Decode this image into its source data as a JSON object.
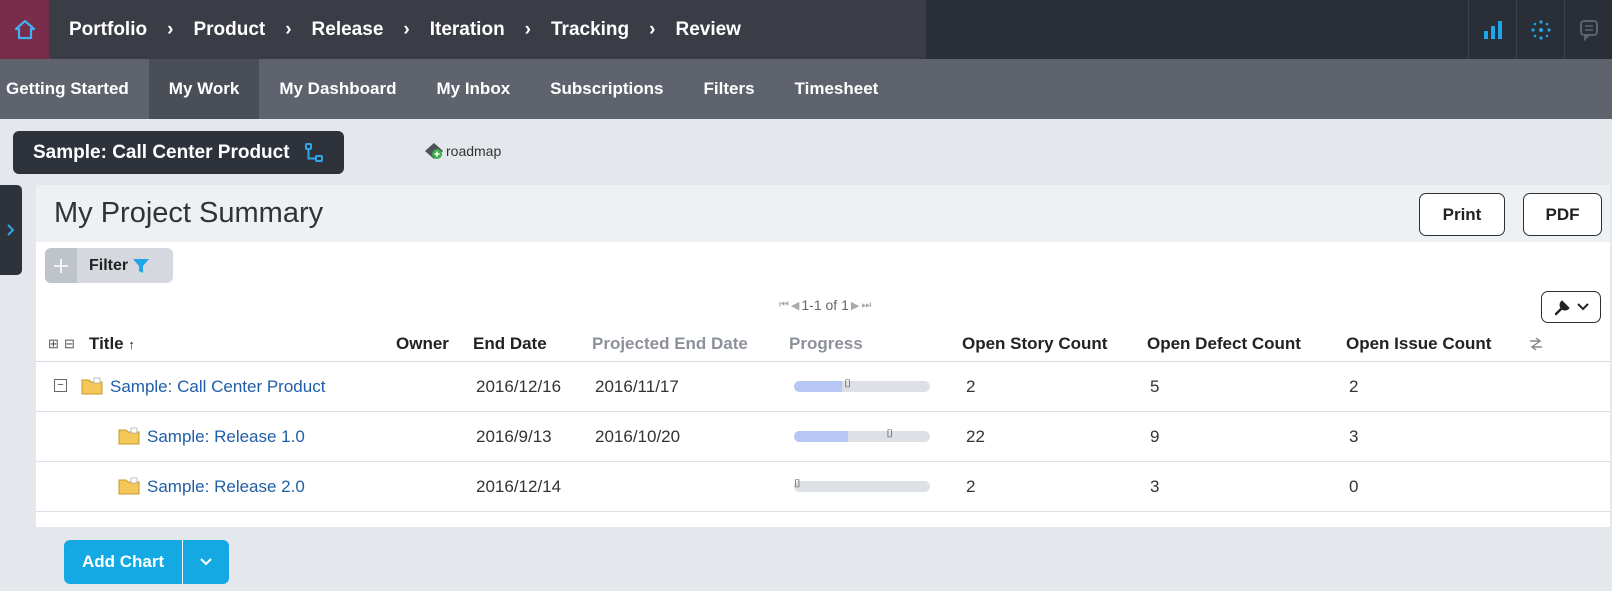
{
  "breadcrumbs": [
    "Portfolio",
    "Product",
    "Release",
    "Iteration",
    "Tracking",
    "Review"
  ],
  "breadcrumb_separator": "›",
  "subnav": [
    "Getting Started",
    "My Work",
    "My Dashboard",
    "My Inbox",
    "Subscriptions",
    "Filters",
    "Timesheet"
  ],
  "context": {
    "title": "Sample: Call Center Product"
  },
  "roadmap_label": "roadmap",
  "panel": {
    "title": "My Project Summary",
    "print_label": "Print",
    "pdf_label": "PDF",
    "filter_label": "Filter",
    "pager": "1-1 of 1"
  },
  "columns": [
    "Title",
    "Owner",
    "End Date",
    "Projected End Date",
    "Progress",
    "Open Story Count",
    "Open Defect Count",
    "Open Issue Count"
  ],
  "rows": [
    {
      "title": "Sample: Call Center Product",
      "owner": "",
      "end_date": "2016/12/16",
      "projected_end_date": "2016/11/17",
      "progress": 0.35,
      "marker": 0.37,
      "open_story_count": "2",
      "open_defect_count": "5",
      "open_issue_count": "2",
      "expandable": true
    },
    {
      "title": "Sample: Release 1.0",
      "owner": "",
      "end_date": "2016/9/13",
      "projected_end_date": "2016/10/20",
      "progress": 0.4,
      "marker": 0.68,
      "open_story_count": "22",
      "open_defect_count": "9",
      "open_issue_count": "3",
      "expandable": false
    },
    {
      "title": "Sample: Release 2.0",
      "owner": "",
      "end_date": "2016/12/14",
      "projected_end_date": "",
      "progress": 0.0,
      "marker": 0.0,
      "open_story_count": "2",
      "open_defect_count": "3",
      "open_issue_count": "0",
      "expandable": false
    }
  ],
  "add_chart_label": "Add Chart",
  "colors": {
    "accent": "#14a9e3",
    "home": "#7a2d4a",
    "nav_dark": "#2a2e37",
    "subnav": "#5e636d",
    "progress_fill": "#b6c7f5"
  }
}
